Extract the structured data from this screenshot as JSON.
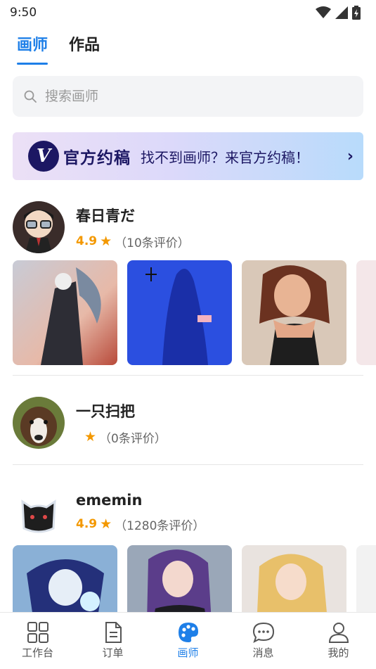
{
  "status_bar": {
    "time": "9:50"
  },
  "tabs": [
    {
      "label": "画师",
      "active": true
    },
    {
      "label": "作品",
      "active": false
    }
  ],
  "search": {
    "placeholder": "搜索画师"
  },
  "banner": {
    "logo_letter": "V",
    "brand": "官方约稿",
    "text": "找不到画师？来官方约稿！",
    "arrow": "›"
  },
  "artists": [
    {
      "name": "春日青だ",
      "score": "4.9",
      "reviews": "（10条评价）",
      "has_works": true
    },
    {
      "name": "一只扫把",
      "score": "",
      "reviews": "（0条评价）",
      "has_works": false
    },
    {
      "name": "ememin",
      "score": "4.9",
      "reviews": "（1280条评价）",
      "has_works": true
    }
  ],
  "bottom_nav": [
    {
      "label": "工作台",
      "icon": "grid-icon",
      "active": false
    },
    {
      "label": "订单",
      "icon": "document-icon",
      "active": false
    },
    {
      "label": "画师",
      "icon": "palette-icon",
      "active": true
    },
    {
      "label": "消息",
      "icon": "chat-bubble-icon",
      "active": false
    },
    {
      "label": "我的",
      "icon": "person-icon",
      "active": false
    }
  ],
  "colors": {
    "accent": "#1e7fe8",
    "star": "#f39800",
    "brand_navy": "#1c1763"
  }
}
